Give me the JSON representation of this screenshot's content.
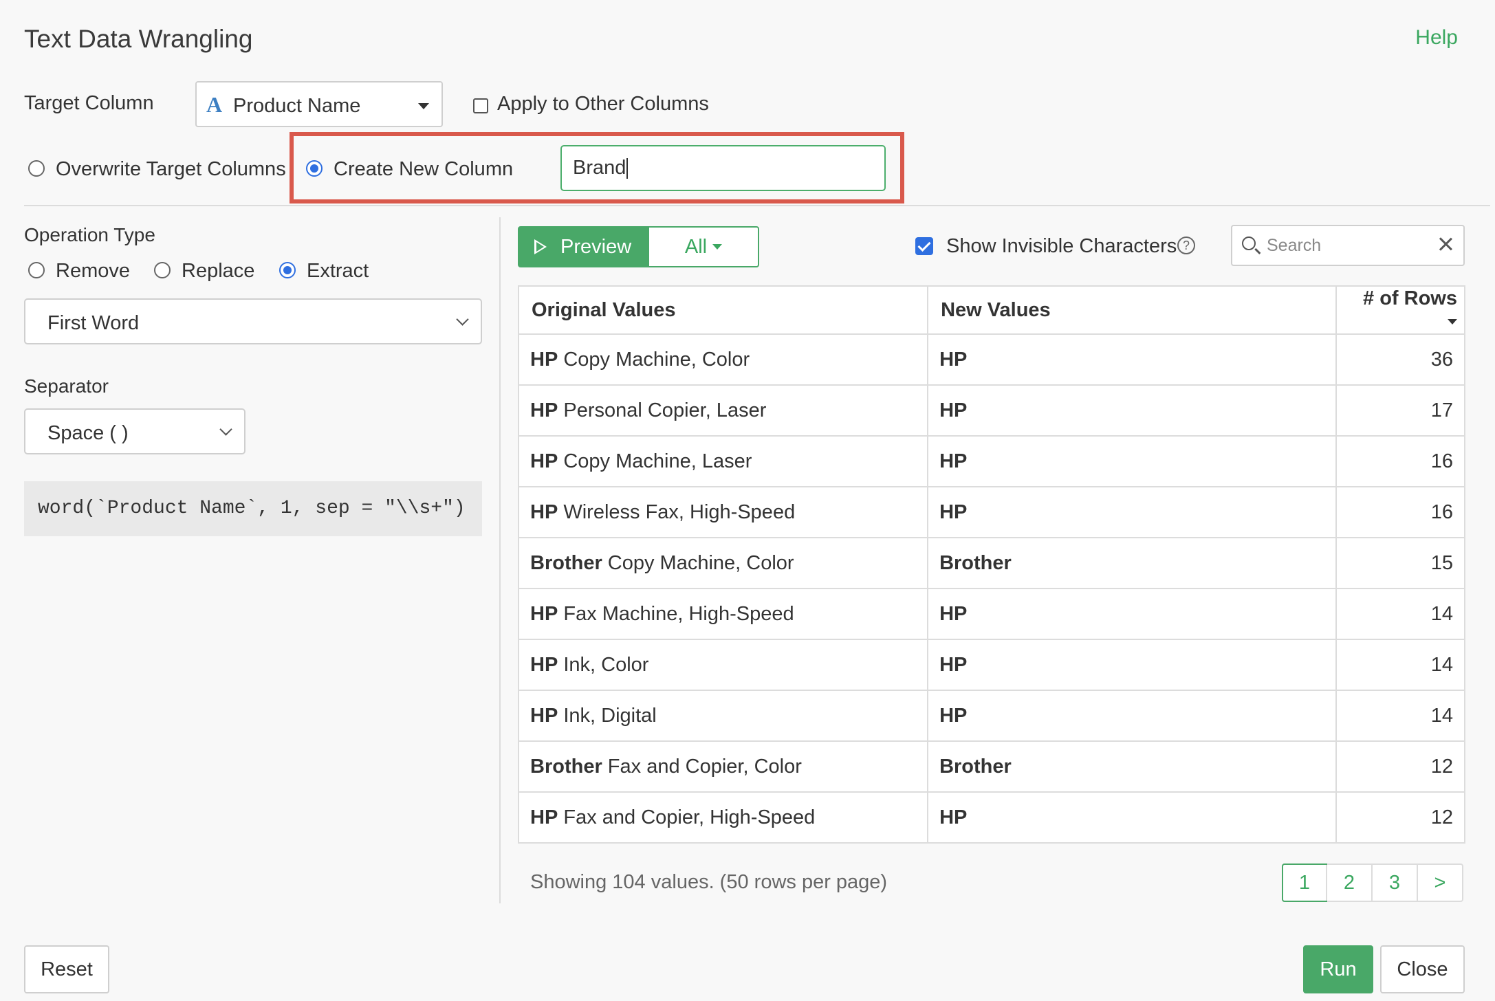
{
  "dialog": {
    "title": "Text Data Wrangling",
    "help_label": "Help"
  },
  "target": {
    "label": "Target Column",
    "type_icon": "A",
    "column_value": "Product Name",
    "apply_other_label": "Apply to Other Columns",
    "apply_other_checked": false
  },
  "output_mode": {
    "overwrite_label": "Overwrite Target Columns",
    "create_label": "Create New Column",
    "selected": "create",
    "new_column_value": "Brand"
  },
  "operation": {
    "label": "Operation Type",
    "options": [
      "Remove",
      "Replace",
      "Extract"
    ],
    "selected": "Extract",
    "extract_mode": "First Word",
    "separator_label": "Separator",
    "separator_value": "Space ( )",
    "code": "word(`Product Name`, 1, sep = \"\\\\s+\")"
  },
  "preview": {
    "preview_label": "Preview",
    "filter_label": "All",
    "show_invisible_label": "Show Invisible Characters",
    "show_invisible_checked": true,
    "help_glyph": "?",
    "search_placeholder": "Search"
  },
  "table": {
    "headers": [
      "Original Values",
      "New Values",
      "# of Rows"
    ],
    "rows": [
      {
        "brand": "HP",
        "rest": " Copy Machine, Color",
        "new": "HP",
        "count": "36"
      },
      {
        "brand": "HP",
        "rest": " Personal Copier, Laser",
        "new": "HP",
        "count": "17"
      },
      {
        "brand": "HP",
        "rest": " Copy Machine, Laser",
        "new": "HP",
        "count": "16"
      },
      {
        "brand": "HP",
        "rest": " Wireless Fax, High-Speed",
        "new": "HP",
        "count": "16"
      },
      {
        "brand": "Brother",
        "rest": " Copy Machine, Color",
        "new": "Brother",
        "count": "15"
      },
      {
        "brand": "HP",
        "rest": " Fax Machine, High-Speed",
        "new": "HP",
        "count": "14"
      },
      {
        "brand": "HP",
        "rest": " Ink, Color",
        "new": "HP",
        "count": "14"
      },
      {
        "brand": "HP",
        "rest": " Ink, Digital",
        "new": "HP",
        "count": "14"
      },
      {
        "brand": "Brother",
        "rest": " Fax and Copier, Color",
        "new": "Brother",
        "count": "12"
      },
      {
        "brand": "HP",
        "rest": " Fax and Copier, High-Speed",
        "new": "HP",
        "count": "12"
      }
    ]
  },
  "footer_info": {
    "showing_text": "Showing 104 values. (50 rows per page)",
    "pages": [
      "1",
      "2",
      "3",
      ">"
    ],
    "active_page": "1"
  },
  "buttons": {
    "reset": "Reset",
    "run": "Run",
    "close": "Close"
  },
  "colors": {
    "accent_green": "#49a868",
    "highlight_red": "#d9594c",
    "checkbox_blue": "#2f6fe0"
  }
}
